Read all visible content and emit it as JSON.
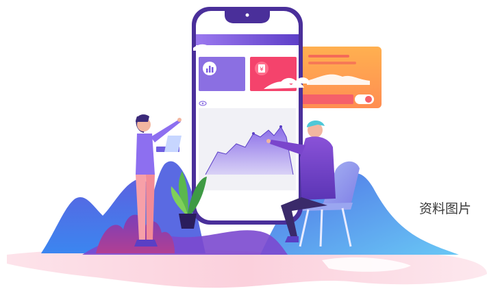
{
  "caption": {
    "text": "资料图片"
  },
  "phone": {
    "card_left_icon": "bar-chart-icon",
    "card_right_icon": "yen-coin-icon",
    "card_right_symbol": "¥"
  },
  "colors": {
    "purple": "#7b5ce3",
    "pink": "#f4436c",
    "orange": "#ff9a4a",
    "blue": "#4a7be8",
    "light_blue": "#5fb2f0",
    "pink_floor": "#fbd3df",
    "phone_frame": "#4a2f9a"
  }
}
